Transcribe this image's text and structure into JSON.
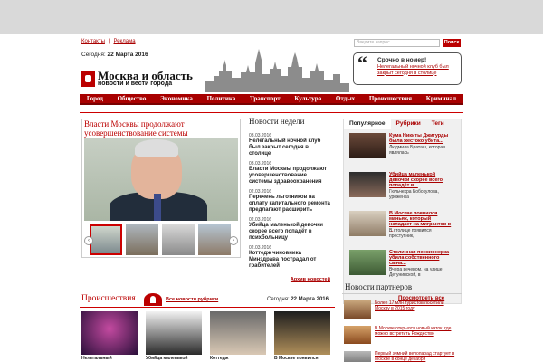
{
  "header": {
    "links": [
      "Контакты",
      "Реклама"
    ],
    "date_label": "Сегодня:",
    "date_value": "22 Марта 2016",
    "logo_title": "Москва и область",
    "logo_subtitle": "новости и вести города",
    "search_placeholder": "Введите запрос...",
    "search_button": "Поиск",
    "urgent_title": "Срочно в номер!",
    "urgent_text": "Нелегальный ночной клуб был закрыт сегодня в столице"
  },
  "nav": [
    "Город",
    "Общество",
    "Экономика",
    "Политика",
    "Транспорт",
    "Культура",
    "Отдых",
    "Происшествия",
    "Криминал"
  ],
  "feature": {
    "title": "Власти Москвы продолжают усовершенствование системы здравоохранения",
    "prev": "‹",
    "next": "›"
  },
  "week": {
    "title": "Новости недели",
    "items": [
      {
        "date": "03.03.2016",
        "title": "Нелегальный ночной клуб был закрыт сегодня в столице"
      },
      {
        "date": "03.03.2016",
        "title": "Власти Москвы продолжают усовершенствование системы здравоохранения"
      },
      {
        "date": "02.03.2016",
        "title": "Перечень льготников на оплату капитального ремонта предлагают расширить"
      },
      {
        "date": "02.03.2016",
        "title": "Убийца маленькой девочки скорее всего попадёт в психбольницу"
      },
      {
        "date": "02.03.2016",
        "title": "Коттедж чиновника Минздрава пострадал от грабителей"
      }
    ],
    "archive": "Архив новостей"
  },
  "popular": {
    "tabs": [
      "Популярное",
      "Рубрики",
      "Теги"
    ],
    "items": [
      {
        "title": "Кума Никиты Джигурды была жестоко убита...",
        "desc": "Людмила Браташ, которая являлась"
      },
      {
        "title": "Убийца маленькой девочки скорее всего попадёт в...",
        "desc": "Гюльчехра Бобокулова, уроженка"
      },
      {
        "title": "В Москве появился маньяк, который нападает на мигрантов в ...",
        "desc": "В столице появился преступник,"
      },
      {
        "title": "Столичная пенсионерка убила собственного сына...",
        "desc": "Вчера вечером, на улице Дегунинской, в"
      }
    ],
    "show_all": "Просмотреть все"
  },
  "incidents": {
    "title": "Происшествия",
    "all_link": "Все новости рубрики",
    "date_label": "Сегодня:",
    "date_value": "22 Марта 2016",
    "captions": [
      "Нелегальный",
      "Убийца маленькой",
      "Коттедж",
      "В Москве появился"
    ]
  },
  "partners": {
    "title": "Новости партнеров",
    "items": [
      "Более 17 млн туристов посетили Москву в 2015 году",
      "В Москве открылся новый каток, где можно встретить Рождество",
      "Первый зимний велопарад стартует в Москве в конце декабря"
    ]
  },
  "colors": {
    "accent": "#a80000",
    "link": "#aa0000",
    "topbar": "#d9d9d9"
  }
}
